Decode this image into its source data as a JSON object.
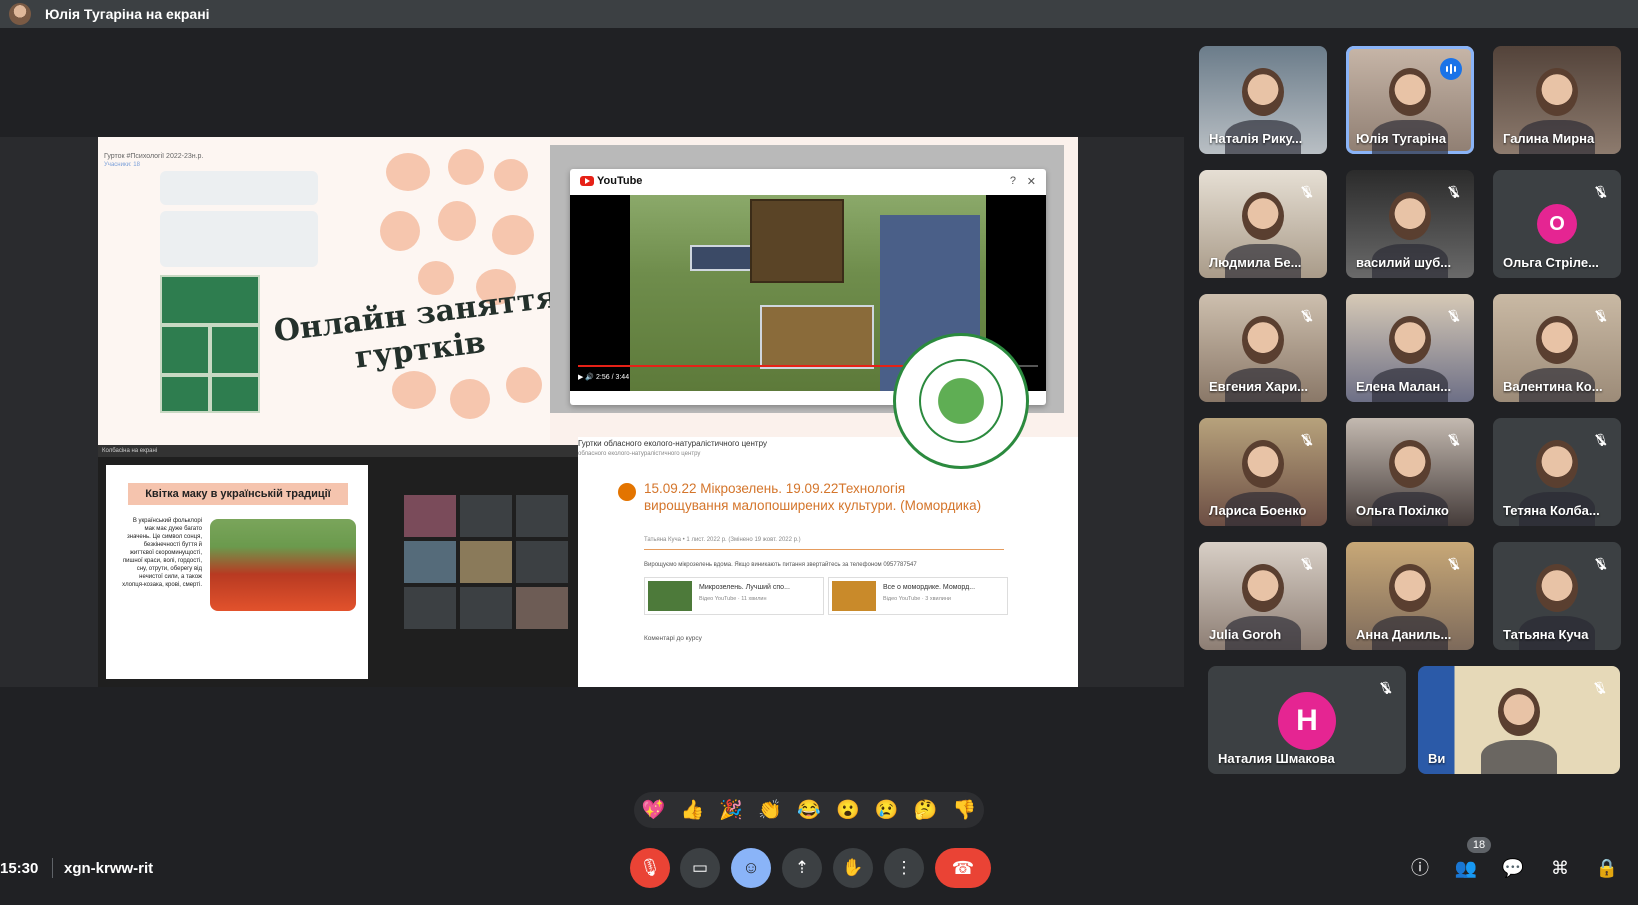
{
  "header": {
    "presenter_label": "Юлія Тугаріна на екрані"
  },
  "shared_screen": {
    "chat_title": "Гурток #Психології 2022-23н.р.",
    "chat_sub": "Учасники: 18",
    "headline": "Онлайн заняття\nгуртків",
    "youtube": {
      "brand": "YouTube",
      "time": "2:56 / 3:44",
      "progress": 0.78
    },
    "mini_call": {
      "header": "Колбасіна на екрані",
      "slide_title": "Квітка маку в українській традиції",
      "slide_text": "В український фольклорі мак має дуже багато значень. Це символ сонця, безкінечності буття й життєвої скороминущості, пишної краси, волі, гордості, сну, отрути, оберегу від нечистої сили, а також хлопця-козака, крові, смерті."
    },
    "classroom": {
      "heading": "Гуртки обласного еколого-натуралістичного центру",
      "subheading": "обласного еколого-натуралістичного центру",
      "post_title": "15.09.22 Мікрозелень. 19.09.22Технологія вирощування малопоширених культури. (Момордика)",
      "post_meta": "Татьяна Куча • 1 лист. 2022 р. (Змінено 19 жовт. 2022 р.)",
      "post_body": "Вирощуємо мікрозелень вдома. Якщо виникають питання звертайтесь за телефоном 0957787547",
      "attachments": [
        {
          "title": "Микрозелень. Лучший спо...",
          "sub": "Відео YouTube · 11 хвилин"
        },
        {
          "title": "Все о момордике. Моморд...",
          "sub": "Відео YouTube · 3 хвилини"
        }
      ],
      "comments": "Коментарі до курсу"
    }
  },
  "participants": [
    {
      "name": "Наталія Рику...",
      "state": "none"
    },
    {
      "name": "Юлія Тугаріна",
      "state": "speaking"
    },
    {
      "name": "Галина Мирна",
      "state": "none"
    },
    {
      "name": "Людмила Бе...",
      "state": "muted"
    },
    {
      "name": "василий шуб...",
      "state": "muted"
    },
    {
      "name": "Ольга Стріле...",
      "state": "muted",
      "avatar_letter": "О"
    },
    {
      "name": "Евгения Хари...",
      "state": "muted"
    },
    {
      "name": "Елена Малан...",
      "state": "muted"
    },
    {
      "name": "Валентина Ко...",
      "state": "muted"
    },
    {
      "name": "Лариса Боенко",
      "state": "muted"
    },
    {
      "name": "Ольга Похілко",
      "state": "muted"
    },
    {
      "name": "Тетяна Колба...",
      "state": "muted"
    },
    {
      "name": "Julia Goroh",
      "state": "muted"
    },
    {
      "name": "Анна Даниль...",
      "state": "muted"
    },
    {
      "name": "Татьяна Куча",
      "state": "muted"
    },
    {
      "name": "Наталия Шмакова",
      "state": "muted",
      "avatar_letter": "Н"
    },
    {
      "name": "Ви",
      "state": "muted"
    }
  ],
  "reactions": [
    "💖",
    "👍",
    "🎉",
    "👏",
    "😂",
    "😮",
    "😢",
    "🤔",
    "👎"
  ],
  "bottom_bar": {
    "time": "15:30",
    "meeting_code": "xgn-krww-rit",
    "participants_count": "18"
  },
  "colors": {
    "accent": "#8ab4f8",
    "danger": "#ea4335",
    "speaking": "#1a73e8"
  }
}
